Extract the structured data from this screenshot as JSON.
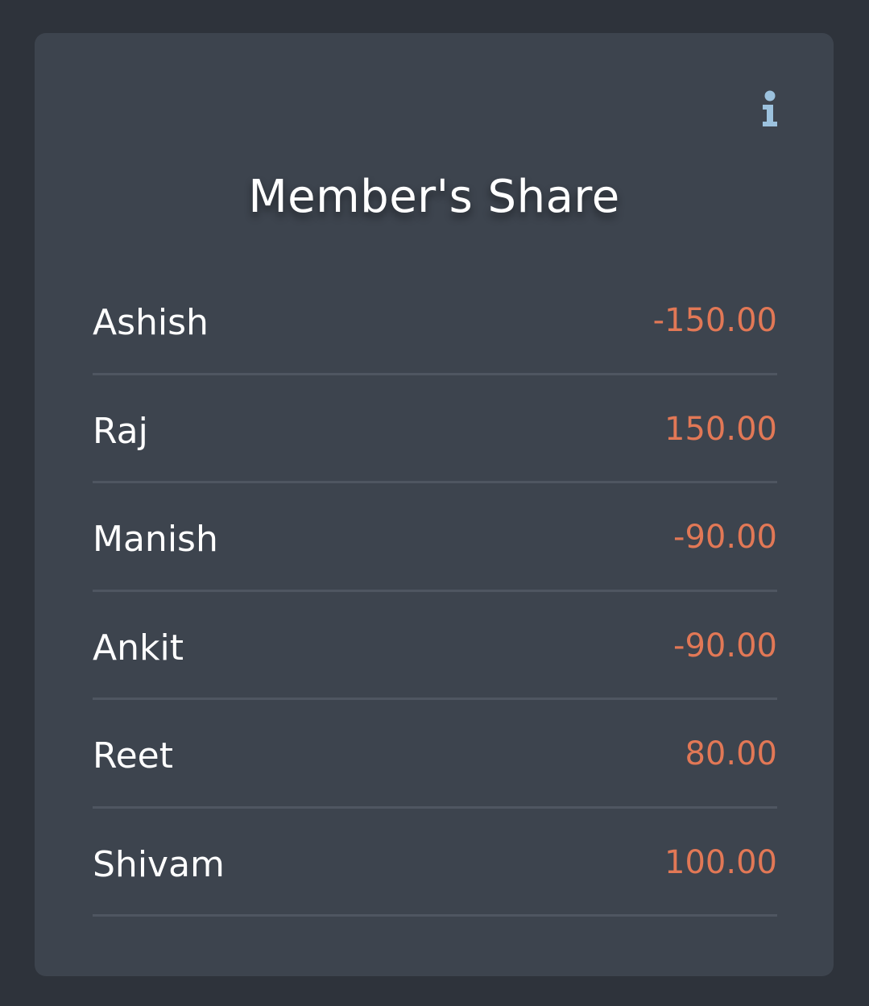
{
  "card": {
    "title": "Member's Share",
    "info_icon": "info-icon"
  },
  "colors": {
    "background": "#2e333b",
    "card": "#3d444e",
    "amount": "#e27856",
    "info": "#9cc2de",
    "divider": "#4f5661"
  },
  "members": [
    {
      "name": "Ashish",
      "amount": "-150.00"
    },
    {
      "name": "Raj",
      "amount": "150.00"
    },
    {
      "name": "Manish",
      "amount": "-90.00"
    },
    {
      "name": "Ankit",
      "amount": "-90.00"
    },
    {
      "name": "Reet",
      "amount": "80.00"
    },
    {
      "name": "Shivam",
      "amount": "100.00"
    }
  ]
}
